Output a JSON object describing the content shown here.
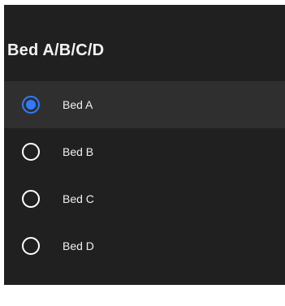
{
  "dialog": {
    "title": "Bed A/B/C/D",
    "options": [
      {
        "label": "Bed A",
        "selected": true
      },
      {
        "label": "Bed B",
        "selected": false
      },
      {
        "label": "Bed C",
        "selected": false
      },
      {
        "label": "Bed D",
        "selected": false
      }
    ]
  },
  "colors": {
    "background": "#202020",
    "selected_row": "#2f2f2f",
    "accent": "#2f7bff",
    "text": "#f0f0f0"
  },
  "icons": {
    "selected": "radio-selected-icon",
    "unselected": "radio-unselected-icon"
  }
}
